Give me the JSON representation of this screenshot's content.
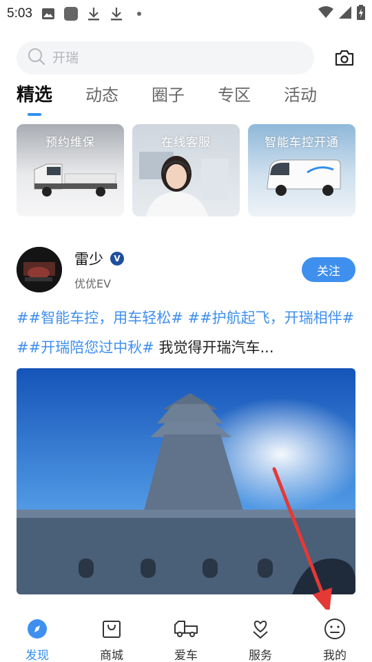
{
  "status_bar": {
    "time": "5:03",
    "icons": [
      "image-icon",
      "app-icon",
      "download-icon",
      "download-icon",
      "dot-icon",
      "wifi-icon",
      "signal-icon",
      "battery-icon"
    ]
  },
  "search": {
    "placeholder": "开瑞"
  },
  "tabs": [
    {
      "label": "精选",
      "active": true
    },
    {
      "label": "动态"
    },
    {
      "label": "圈子"
    },
    {
      "label": "专区"
    },
    {
      "label": "活动"
    }
  ],
  "service_cards": [
    {
      "label": "预约维保"
    },
    {
      "label": "在线客服"
    },
    {
      "label": "智能车控开通"
    }
  ],
  "post": {
    "author": "雷少",
    "badge": "V",
    "brand": "优优EV",
    "follow_label": "关注",
    "tags": [
      "##智能车控，用车轻松#",
      "##护航起飞，开瑞相伴#",
      "##开瑞陪您过中秋#"
    ],
    "text": " 我觉得开瑞汽车..."
  },
  "bottom_nav": [
    {
      "label": "发现",
      "icon": "compass-icon",
      "active": true
    },
    {
      "label": "商城",
      "icon": "shopping-bag-icon"
    },
    {
      "label": "爱车",
      "icon": "truck-icon"
    },
    {
      "label": "服务",
      "icon": "heart-hand-icon"
    },
    {
      "label": "我的",
      "icon": "smile-face-icon"
    }
  ],
  "colors": {
    "accent": "#3f8fef",
    "tag": "#3f8fef",
    "annotation_arrow": "#e53935"
  }
}
